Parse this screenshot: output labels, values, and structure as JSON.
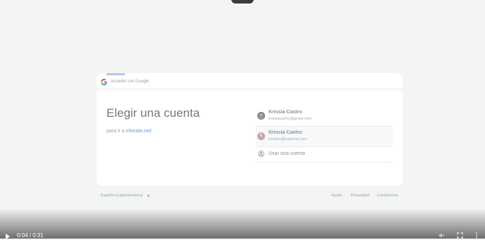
{
  "header": {
    "text": "Acceder con Google"
  },
  "main": {
    "title": "Elegir una cuenta",
    "subtitle_prefix": "para ir a",
    "subtitle_link": "elecate.net"
  },
  "progress": {
    "fraction": 0.06
  },
  "accounts": [
    {
      "name": "Krissia Castro",
      "email": "krissiacastro@gmail.com",
      "avatar": "photo"
    },
    {
      "name": "Krissia Castro",
      "email": "kcastro@cdueme.com",
      "avatar": "K"
    }
  ],
  "other_account": {
    "label": "Usar otra cuenta"
  },
  "footer": {
    "language": "Español (Latinoamérica)",
    "links": [
      "Ayuda",
      "Privacidad",
      "Condiciones"
    ]
  },
  "video": {
    "time": "0:04 / 0:31",
    "icons": [
      "play-icon",
      "volume-icon",
      "fullscreen-icon",
      "more-icon"
    ]
  },
  "colors": {
    "link": "#8fb2e6",
    "progress": "#b7c8ec"
  }
}
